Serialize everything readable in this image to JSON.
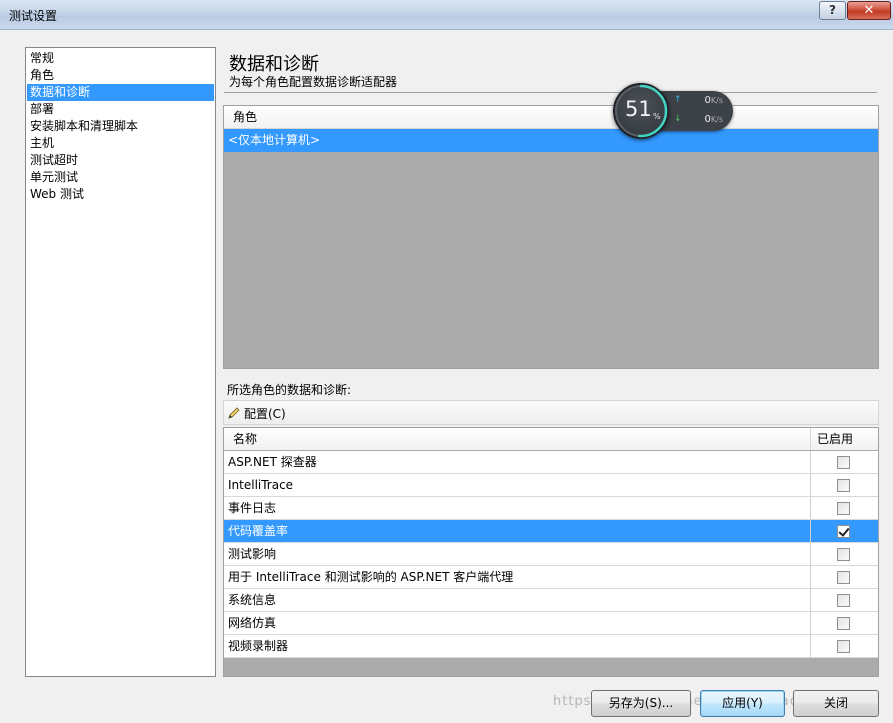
{
  "window": {
    "title": "测试设置",
    "help_label": "?",
    "close_label": "✕"
  },
  "nav": {
    "items": [
      {
        "label": "常规",
        "selected": false
      },
      {
        "label": "角色",
        "selected": false
      },
      {
        "label": "数据和诊断",
        "selected": true
      },
      {
        "label": "部署",
        "selected": false
      },
      {
        "label": "安装脚本和清理脚本",
        "selected": false
      },
      {
        "label": "主机",
        "selected": false
      },
      {
        "label": "测试超时",
        "selected": false
      },
      {
        "label": "单元测试",
        "selected": false
      },
      {
        "label": "Web 测试",
        "selected": false
      }
    ]
  },
  "main": {
    "title": "数据和诊断",
    "subtitle": "为每个角色配置数据诊断适配器",
    "roles": {
      "header": "角色",
      "rows": [
        "<仅本地计算机>"
      ]
    },
    "selected_role_label": "所选角色的数据和诊断:",
    "toolbar": {
      "config_label": "配置(C)"
    },
    "grid": {
      "col_name": "名称",
      "col_enabled": "已启用",
      "rows": [
        {
          "name": "ASP.NET 探查器",
          "enabled": false,
          "selected": false
        },
        {
          "name": "IntelliTrace",
          "enabled": false,
          "selected": false
        },
        {
          "name": "事件日志",
          "enabled": false,
          "selected": false
        },
        {
          "name": "代码覆盖率",
          "enabled": true,
          "selected": true
        },
        {
          "name": "测试影响",
          "enabled": false,
          "selected": false
        },
        {
          "name": "用于 IntelliTrace 和测试影响的 ASP.NET 客户端代理",
          "enabled": false,
          "selected": false
        },
        {
          "name": "系统信息",
          "enabled": false,
          "selected": false
        },
        {
          "name": "网络仿真",
          "enabled": false,
          "selected": false
        },
        {
          "name": "视频录制器",
          "enabled": false,
          "selected": false
        }
      ]
    }
  },
  "buttons": {
    "save_as": "另存为(S)...",
    "apply": "应用(Y)",
    "close": "关闭"
  },
  "watermark": "https://blog.csdn.net/dongyu_lao",
  "net_widget": {
    "percent": "51",
    "percent_unit": "%",
    "upload": "0",
    "download": "0",
    "unit": "K/s",
    "upload_arrow": "↑",
    "download_arrow": "↓",
    "upload_color": "#35b6e6",
    "download_color": "#4cc35a"
  },
  "colors": {
    "selection": "#3399ff",
    "panel_gray": "#ababab"
  }
}
